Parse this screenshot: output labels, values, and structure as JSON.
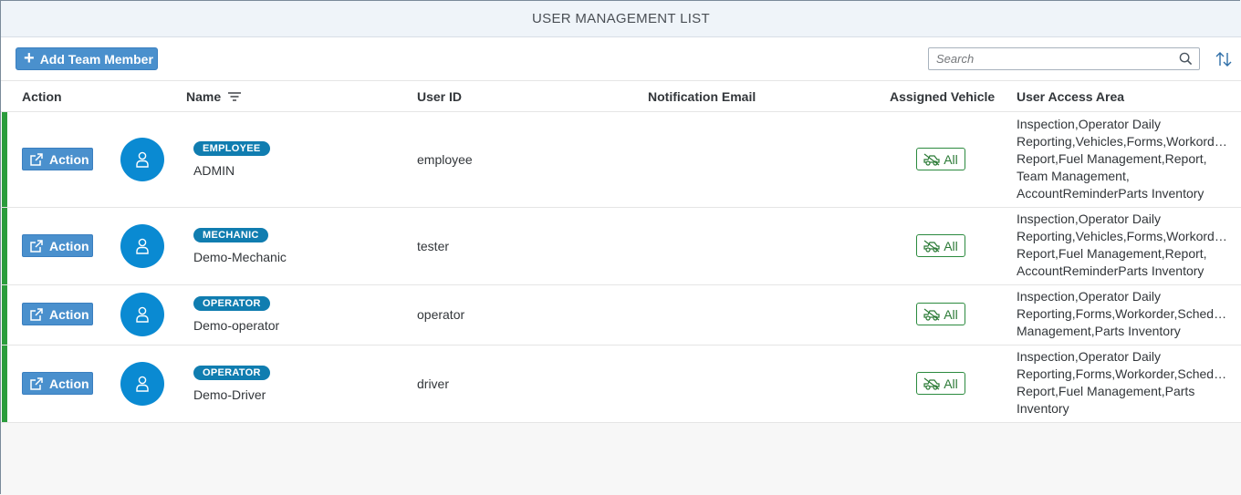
{
  "title": "USER MANAGEMENT LIST",
  "toolbar": {
    "add_label": "Add Team Member",
    "search_placeholder": "Search"
  },
  "columns": {
    "action": "Action",
    "name": "Name",
    "user_id": "User ID",
    "notification_email": "Notification Email",
    "assigned_vehicle": "Assigned Vehicle",
    "user_access_area": "User Access Area"
  },
  "rows": [
    {
      "action_label": "Action",
      "role": "EMPLOYEE",
      "name": "ADMIN",
      "user_id": "employee",
      "email": "",
      "vehicle": "All",
      "access_lines": [
        "Inspection,Operator Daily",
        "Reporting,Vehicles,Forms,Workorder,Schedule",
        "Report,Fuel Management,Report,",
        "Team Management,",
        "AccountReminderParts Inventory"
      ]
    },
    {
      "action_label": "Action",
      "role": "MECHANIC",
      "name": "Demo-Mechanic",
      "user_id": "tester",
      "email": "",
      "vehicle": "All",
      "access_lines": [
        "Inspection,Operator Daily",
        "Reporting,Vehicles,Forms,Workorder,Schedule",
        "Report,Fuel Management,Report,",
        "AccountReminderParts Inventory"
      ]
    },
    {
      "action_label": "Action",
      "role": "OPERATOR",
      "name": "Demo-operator",
      "user_id": "operator",
      "email": "",
      "vehicle": "All",
      "access_lines": [
        "Inspection,Operator Daily",
        "Reporting,Forms,Workorder,Schedule",
        "Management,Parts Inventory"
      ]
    },
    {
      "action_label": "Action",
      "role": "OPERATOR",
      "name": "Demo-Driver",
      "user_id": "driver",
      "email": "",
      "vehicle": "All",
      "access_lines": [
        "Inspection,Operator Daily",
        "Reporting,Forms,Workorder,Schedule",
        "Report,Fuel Management,Parts",
        "Inventory"
      ]
    }
  ],
  "colors": {
    "accent": "#4a90cd",
    "role_badge": "#107db0",
    "avatar": "#0a8ad2",
    "status_bar": "#2b9c3c",
    "vehicle_border": "#2b8a3e"
  },
  "icons": {
    "add": "plus-icon",
    "search": "search-icon",
    "sort": "sort-icon",
    "filter": "filter-icon",
    "action": "external-link-icon",
    "avatar": "person-icon",
    "vehicle": "vehicle-icon"
  }
}
